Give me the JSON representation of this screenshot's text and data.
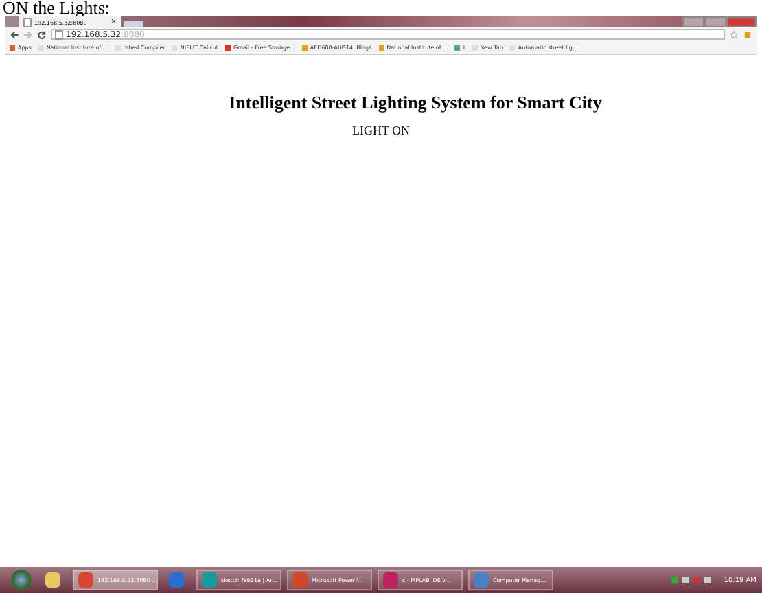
{
  "caption": "ON the Lights:",
  "browser": {
    "tab": {
      "label": "192.168.5.32:8080",
      "close": "×"
    },
    "address": {
      "host": "192.168.5.32",
      "port": ":8080"
    },
    "bookmarks": [
      {
        "label": "Apps",
        "kind": "apps"
      },
      {
        "label": "National Institute of ...",
        "kind": "page"
      },
      {
        "label": "mbed Compiler",
        "kind": "page"
      },
      {
        "label": "NIELIT Calicut",
        "kind": "page"
      },
      {
        "label": "Gmail - Free Storage...",
        "kind": "mail"
      },
      {
        "label": "AED600-AUG14: Blogs",
        "kind": "folder"
      },
      {
        "label": "National Institute of ...",
        "kind": "folder"
      },
      {
        "label": "I",
        "kind": "google"
      },
      {
        "label": "New Tab",
        "kind": "page"
      },
      {
        "label": "Automatic street lig...",
        "kind": "page"
      }
    ]
  },
  "page": {
    "title": "Intelligent Street Lighting System for Smart City",
    "status": "LIGHT ON"
  },
  "taskbar": {
    "items": [
      {
        "kind": "explorer",
        "selected": false
      },
      {
        "label": "192.168.5.32:8080 ...",
        "kind": "chrome",
        "selected": true
      },
      {
        "kind": "ie",
        "selected": false
      },
      {
        "label": "sketch_feb21a | Ar...",
        "kind": "arduino",
        "selected": false
      },
      {
        "label": "Microsoft PowerP...",
        "kind": "ppt",
        "selected": false
      },
      {
        "label": "c - MPLAB IDE v...",
        "kind": "mplab",
        "selected": false
      },
      {
        "label": "Computer Manag...",
        "kind": "computer",
        "selected": false
      }
    ],
    "clock": "10:19 AM"
  }
}
